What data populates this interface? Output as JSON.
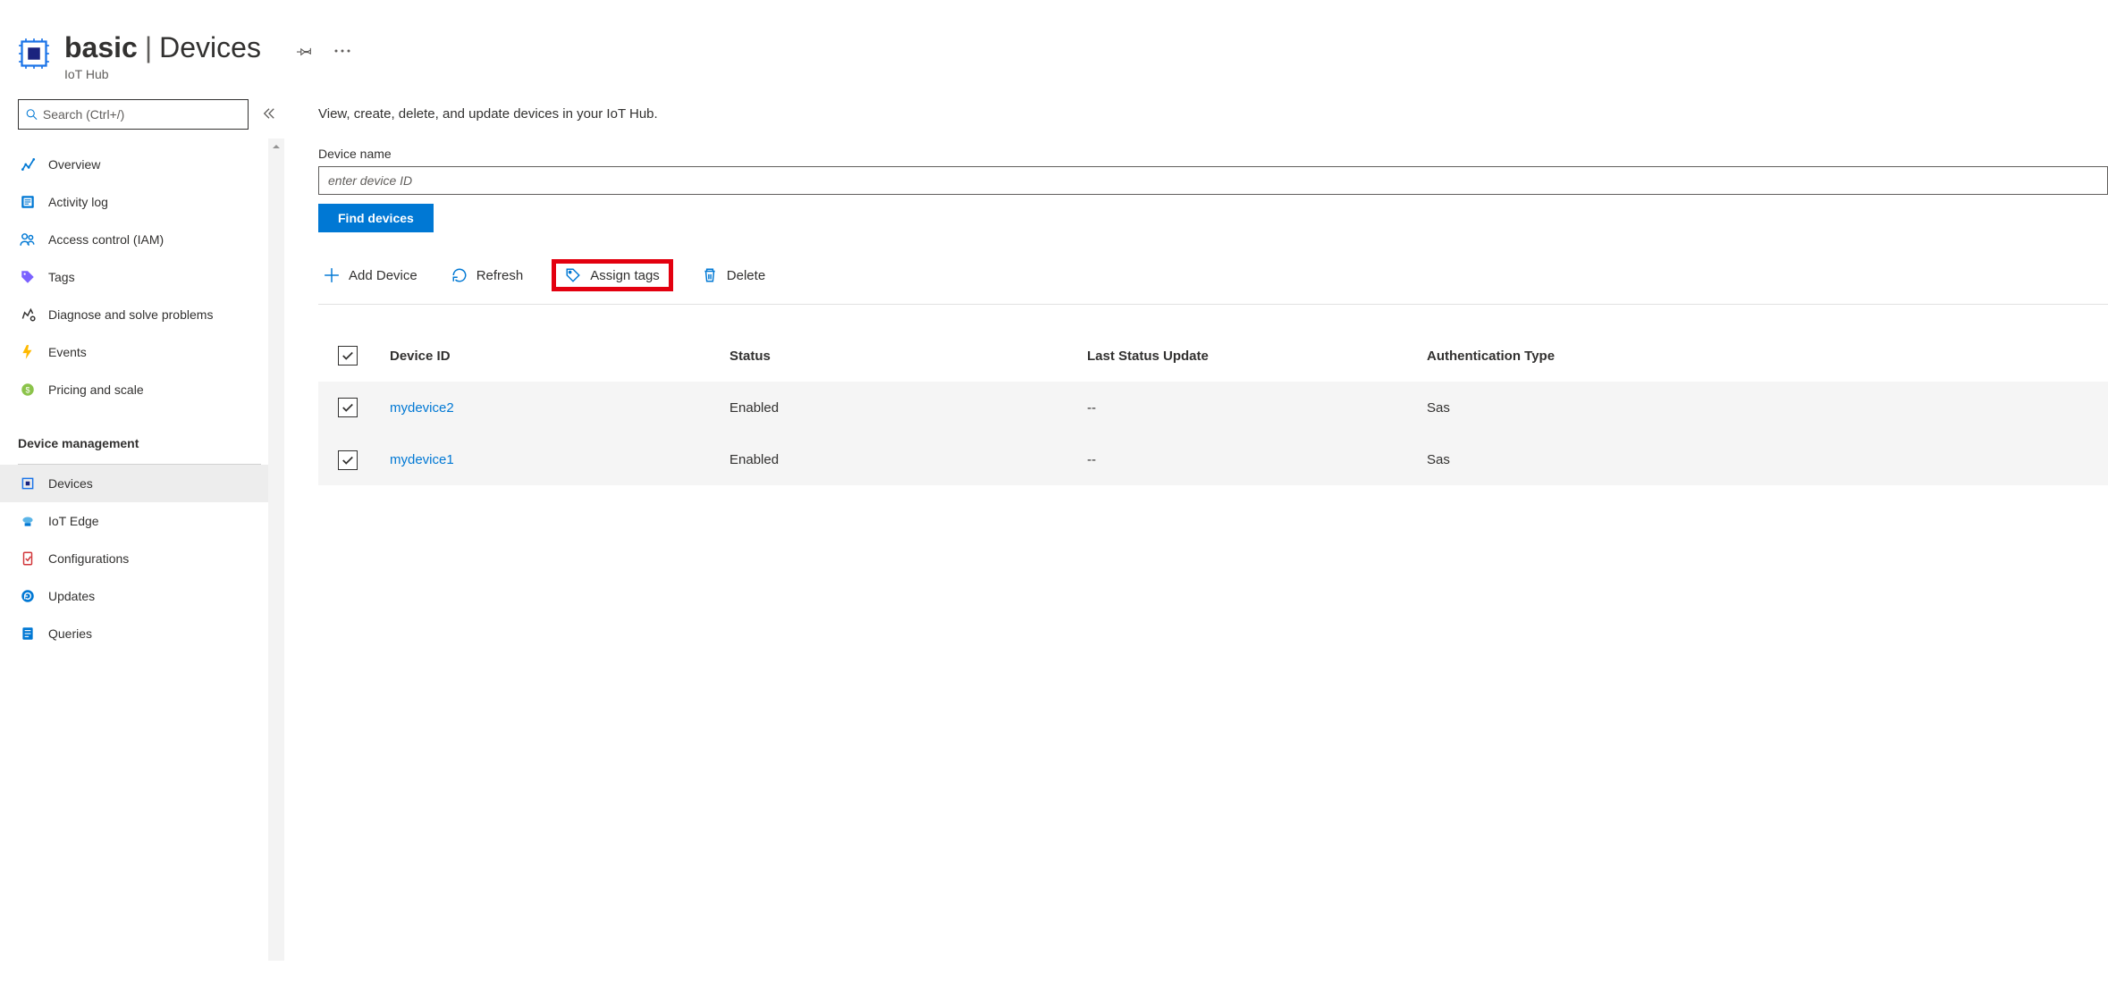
{
  "header": {
    "resource_name": "basic",
    "page_name": "Devices",
    "subtitle": "IoT Hub"
  },
  "sidebar": {
    "search_placeholder": "Search (Ctrl+/)",
    "items_top": [
      {
        "label": "Overview",
        "icon": "overview"
      },
      {
        "label": "Activity log",
        "icon": "activity-log"
      },
      {
        "label": "Access control (IAM)",
        "icon": "access-control"
      },
      {
        "label": "Tags",
        "icon": "tags"
      },
      {
        "label": "Diagnose and solve problems",
        "icon": "diagnose"
      },
      {
        "label": "Events",
        "icon": "events"
      },
      {
        "label": "Pricing and scale",
        "icon": "pricing"
      }
    ],
    "section_header": "Device management",
    "items_device": [
      {
        "label": "Devices",
        "icon": "devices",
        "active": true
      },
      {
        "label": "IoT Edge",
        "icon": "iot-edge"
      },
      {
        "label": "Configurations",
        "icon": "configurations"
      },
      {
        "label": "Updates",
        "icon": "updates"
      },
      {
        "label": "Queries",
        "icon": "queries"
      }
    ]
  },
  "main": {
    "description": "View, create, delete, and update devices in your IoT Hub.",
    "device_name_label": "Device name",
    "device_name_placeholder": "enter device ID",
    "find_button": "Find devices",
    "toolbar": {
      "add": "Add Device",
      "refresh": "Refresh",
      "assign_tags": "Assign tags",
      "delete": "Delete"
    },
    "table": {
      "columns": [
        "Device ID",
        "Status",
        "Last Status Update",
        "Authentication Type"
      ],
      "rows": [
        {
          "device_id": "mydevice2",
          "status": "Enabled",
          "last_update": "--",
          "auth_type": "Sas",
          "checked": true
        },
        {
          "device_id": "mydevice1",
          "status": "Enabled",
          "last_update": "--",
          "auth_type": "Sas",
          "checked": true
        }
      ]
    }
  }
}
